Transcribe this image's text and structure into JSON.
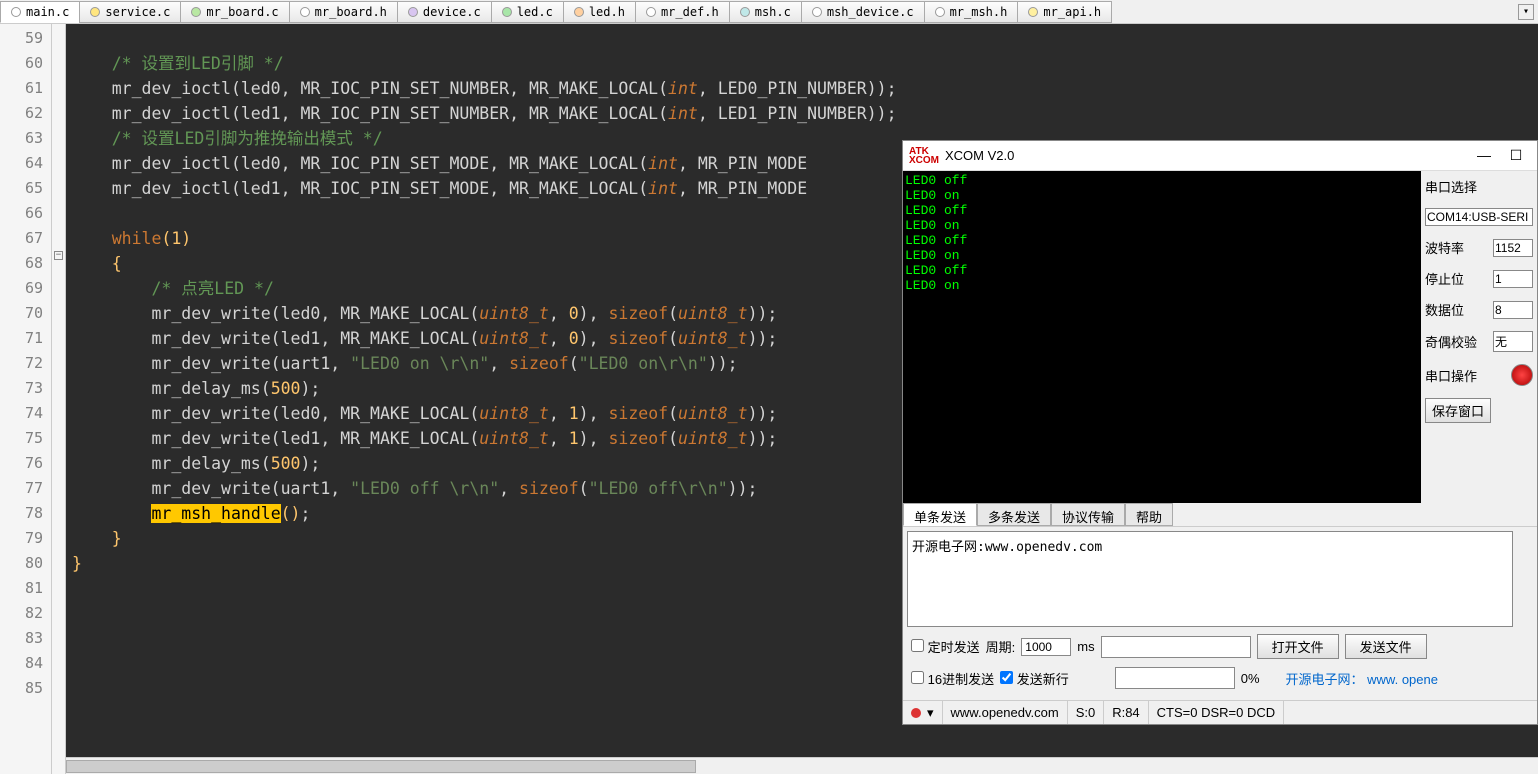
{
  "tabs": [
    {
      "name": "main.c",
      "color": "#ffffff",
      "active": true
    },
    {
      "name": "service.c",
      "color": "#ffe680"
    },
    {
      "name": "mr_board.c",
      "color": "#b9e8a3"
    },
    {
      "name": "mr_board.h",
      "color": "#ffffff"
    },
    {
      "name": "device.c",
      "color": "#d8c5f0"
    },
    {
      "name": "led.c",
      "color": "#a8e6a8"
    },
    {
      "name": "led.h",
      "color": "#ffd0a0"
    },
    {
      "name": "mr_def.h",
      "color": "#ffffff"
    },
    {
      "name": "msh.c",
      "color": "#c0e8e8"
    },
    {
      "name": "msh_device.c",
      "color": "#ffffff"
    },
    {
      "name": "mr_msh.h",
      "color": "#ffffff"
    },
    {
      "name": "mr_api.h",
      "color": "#fff0a0"
    }
  ],
  "lines_start": 59,
  "lines_end": 85,
  "code": {
    "l60_comment": "/* 设置到LED引脚 */",
    "l61": "mr_dev_ioctl(led0, MR_IOC_PIN_SET_NUMBER, MR_MAKE_LOCAL(int, LED0_PIN_NUMBER));",
    "l62": "mr_dev_ioctl(led1, MR_IOC_PIN_SET_NUMBER, MR_MAKE_LOCAL(int, LED1_PIN_NUMBER));",
    "l63_comment": "/* 设置LED引脚为推挽输出模式 */",
    "l64": "mr_dev_ioctl(led0, MR_IOC_PIN_SET_MODE, MR_MAKE_LOCAL(int, MR_PIN_MODE",
    "l65": "mr_dev_ioctl(led1, MR_IOC_PIN_SET_MODE, MR_MAKE_LOCAL(int, MR_PIN_MODE",
    "l67_while": "while",
    "l67_cond": "1",
    "l69_comment": "/* 点亮LED */",
    "write": "mr_dev_write",
    "delay": "mr_delay_ms",
    "sizeofk": "sizeof",
    "make": "MR_MAKE_LOCAL",
    "u8": "uint8_t",
    "l72_str": "\"LED0 on \\r\\n\"",
    "l72_str2": "\"LED0 on\\r\\n\"",
    "l77_str": "\"LED0 off \\r\\n\"",
    "l77_str2": "\"LED0 off\\r\\n\"",
    "n0": "0",
    "n1": "1",
    "n500": "500",
    "led0": "led0",
    "led1": "led1",
    "uart1": "uart1",
    "l78_hl": "mr_msh_handle"
  },
  "xcom": {
    "title": "XCOM V2.0",
    "logo_l1": "ATK",
    "logo_l2": "XCOM",
    "terminal_lines": [
      "LED0 off",
      "LED0 on",
      "LED0 off",
      "LED0 on",
      "LED0 off",
      "LED0 on",
      "LED0 off",
      "LED0 on"
    ],
    "side": {
      "port_label": "串口选择",
      "port_value": "COM14:USB-SERI",
      "baud_label": "波特率",
      "baud_value": "1152",
      "stop_label": "停止位",
      "stop_value": "1",
      "data_label": "数据位",
      "data_value": "8",
      "parity_label": "奇偶校验",
      "parity_value": "无",
      "op_label": "串口操作",
      "save_label": "保存窗口"
    },
    "xtabs": [
      "单条发送",
      "多条发送",
      "协议传输",
      "帮助"
    ],
    "send_text": "开源电子网:www.openedv.com",
    "ctrl": {
      "timed": "定时发送",
      "period_label": "周期:",
      "period_value": "1000",
      "unit": "ms",
      "hex": "16进制发送",
      "newline": "发送新行",
      "open_file": "打开文件",
      "send_file": "发送文件",
      "pct": "0%",
      "link": "开源电子网： www. opene"
    },
    "status": {
      "site": "www.openedv.com",
      "s": "S:0",
      "r": "R:84",
      "cts": "CTS=0 DSR=0 DCD"
    }
  }
}
